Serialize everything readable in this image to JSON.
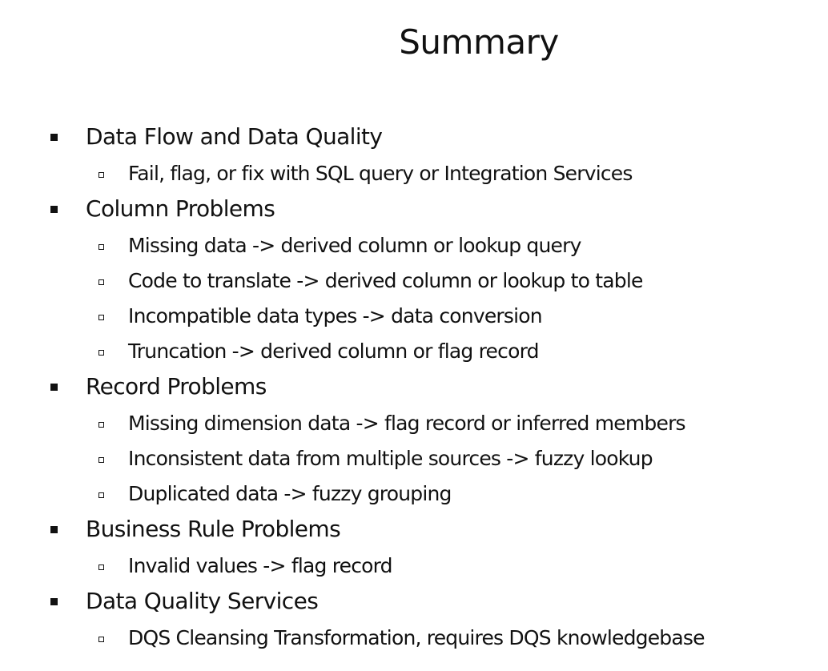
{
  "slide": {
    "title": "Summary",
    "sections": [
      {
        "heading": "Data Flow and Data Quality",
        "items": [
          "Fail, flag, or fix with SQL query or Integration Services"
        ]
      },
      {
        "heading": "Column Problems",
        "items": [
          "Missing data -> derived column or lookup query",
          "Code to translate -> derived column or lookup to table",
          "Incompatible data types -> data conversion",
          "Truncation -> derived column or flag record"
        ]
      },
      {
        "heading": "Record Problems",
        "items": [
          "Missing dimension data -> flag record or inferred members",
          "Inconsistent data from multiple sources -> fuzzy lookup",
          "Duplicated data -> fuzzy grouping"
        ]
      },
      {
        "heading": "Business Rule Problems",
        "items": [
          "Invalid values -> flag record"
        ]
      },
      {
        "heading": "Data Quality Services",
        "items": [
          "DQS Cleansing Transformation, requires DQS knowledgebase"
        ]
      }
    ]
  }
}
